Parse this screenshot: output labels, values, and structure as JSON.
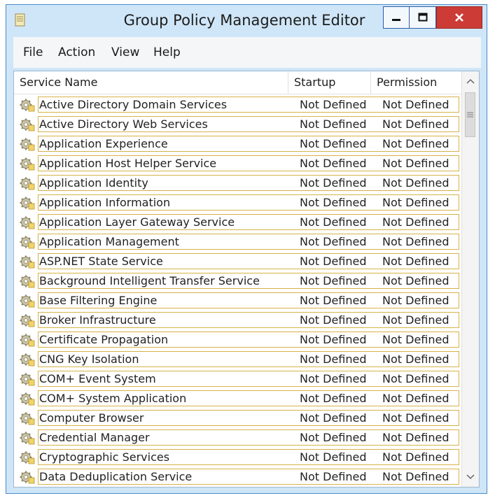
{
  "window": {
    "title": "Group Policy Management Editor",
    "controls": {
      "minimize_icon": "minimize-icon",
      "maximize_icon": "maximize-icon",
      "close_icon": "close-icon",
      "close_color": "#cc3b35"
    }
  },
  "menu": {
    "items": [
      {
        "label": "File"
      },
      {
        "label": "Action"
      },
      {
        "label": "View"
      },
      {
        "label": "Help"
      }
    ]
  },
  "table": {
    "columns": {
      "name": "Service Name",
      "startup": "Startup",
      "permission": "Permission"
    },
    "rows": [
      {
        "name": "Active Directory Domain Services",
        "startup": "Not Defined",
        "permission": "Not Defined"
      },
      {
        "name": "Active Directory Web Services",
        "startup": "Not Defined",
        "permission": "Not Defined"
      },
      {
        "name": "Application Experience",
        "startup": "Not Defined",
        "permission": "Not Defined"
      },
      {
        "name": "Application Host Helper Service",
        "startup": "Not Defined",
        "permission": "Not Defined"
      },
      {
        "name": "Application Identity",
        "startup": "Not Defined",
        "permission": "Not Defined"
      },
      {
        "name": "Application Information",
        "startup": "Not Defined",
        "permission": "Not Defined"
      },
      {
        "name": "Application Layer Gateway Service",
        "startup": "Not Defined",
        "permission": "Not Defined"
      },
      {
        "name": "Application Management",
        "startup": "Not Defined",
        "permission": "Not Defined"
      },
      {
        "name": "ASP.NET State Service",
        "startup": "Not Defined",
        "permission": "Not Defined"
      },
      {
        "name": "Background Intelligent Transfer Service",
        "startup": "Not Defined",
        "permission": "Not Defined"
      },
      {
        "name": "Base Filtering Engine",
        "startup": "Not Defined",
        "permission": "Not Defined"
      },
      {
        "name": "Broker Infrastructure",
        "startup": "Not Defined",
        "permission": "Not Defined"
      },
      {
        "name": "Certificate Propagation",
        "startup": "Not Defined",
        "permission": "Not Defined"
      },
      {
        "name": "CNG Key Isolation",
        "startup": "Not Defined",
        "permission": "Not Defined"
      },
      {
        "name": "COM+ Event System",
        "startup": "Not Defined",
        "permission": "Not Defined"
      },
      {
        "name": "COM+ System Application",
        "startup": "Not Defined",
        "permission": "Not Defined"
      },
      {
        "name": "Computer Browser",
        "startup": "Not Defined",
        "permission": "Not Defined"
      },
      {
        "name": "Credential Manager",
        "startup": "Not Defined",
        "permission": "Not Defined"
      },
      {
        "name": "Cryptographic Services",
        "startup": "Not Defined",
        "permission": "Not Defined"
      },
      {
        "name": "Data Deduplication Service",
        "startup": "Not Defined",
        "permission": "Not Defined"
      }
    ],
    "row_icon": "gear-icon",
    "highlight_color": "#d6b24a"
  }
}
